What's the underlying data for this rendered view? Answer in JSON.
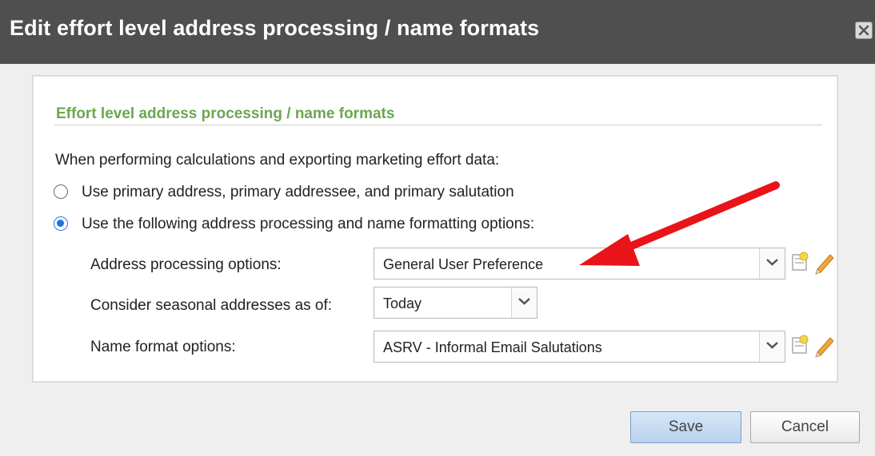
{
  "dialog": {
    "title": "Edit effort level address processing / name formats"
  },
  "section": {
    "title": "Effort level address processing / name formats",
    "intro": "When performing calculations and exporting marketing effort data:"
  },
  "options": {
    "primary_label": "Use primary address, primary addressee, and primary salutation",
    "primary_selected": false,
    "custom_label": "Use the following address processing and name formatting options:",
    "custom_selected": true
  },
  "fields": {
    "address_processing": {
      "label": "Address processing options:",
      "value": "General User Preference"
    },
    "seasonal": {
      "label": "Consider seasonal addresses as of:",
      "value": "Today"
    },
    "name_format": {
      "label": "Name format options:",
      "value": "ASRV - Informal Email Salutations"
    }
  },
  "buttons": {
    "save": "Save",
    "cancel": "Cancel"
  },
  "colors": {
    "titlebar": "#4f4f4f",
    "section_title": "#6aa84f",
    "radio_selected": "#1a73e8",
    "annotation_arrow": "#e8141a"
  },
  "icons": {
    "close": "close-icon",
    "dropdown": "chevron-down-icon",
    "add": "add-new-icon",
    "edit": "pencil-icon",
    "annotation": "red-arrow"
  }
}
